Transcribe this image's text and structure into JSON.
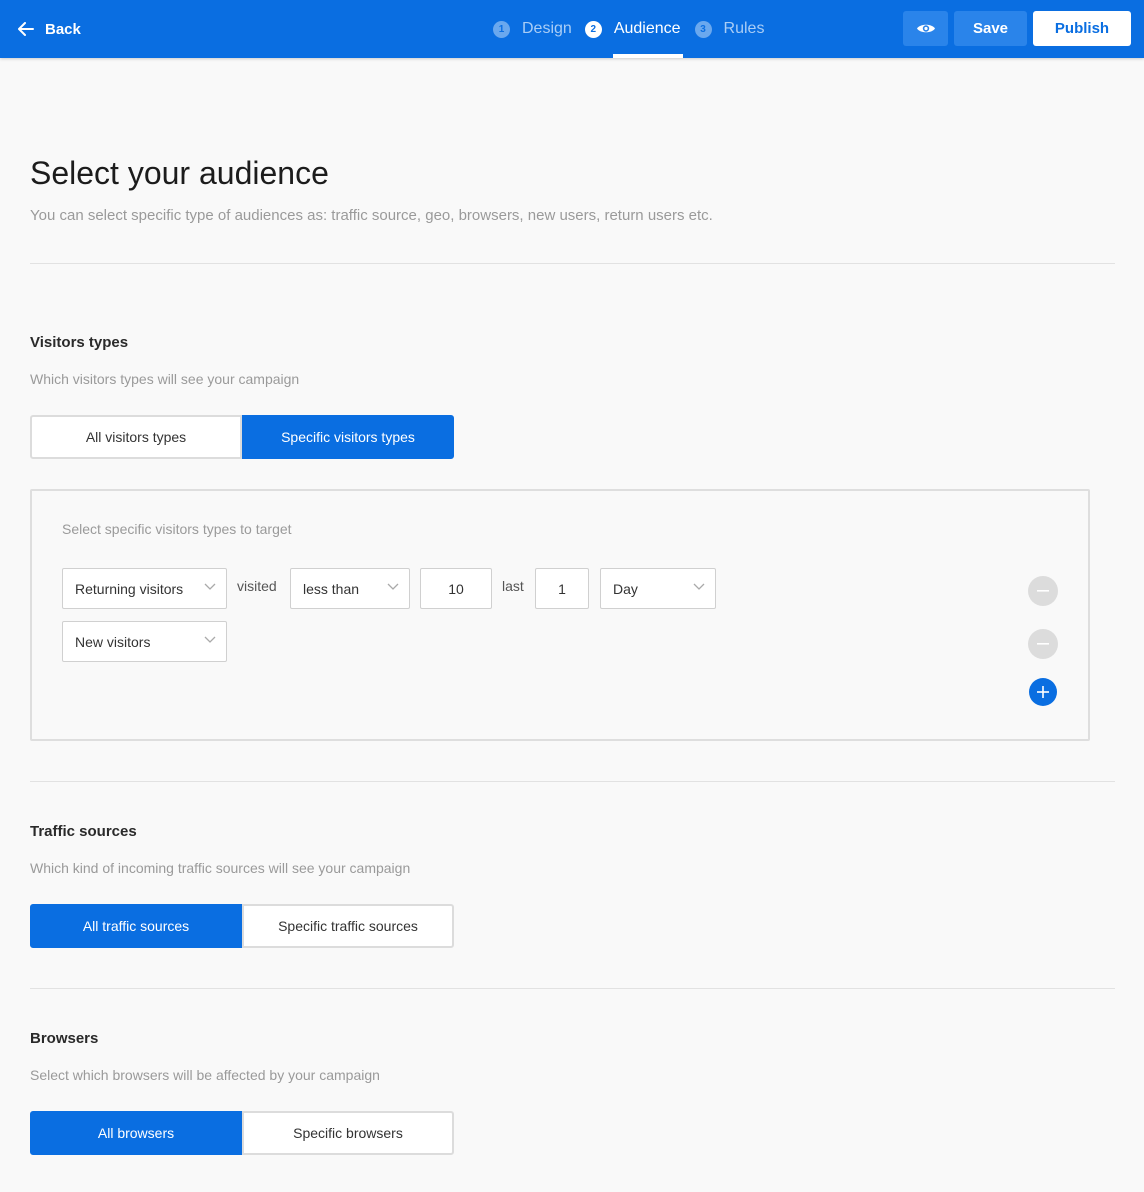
{
  "topbar": {
    "back_label": "Back",
    "steps": [
      {
        "num": "1",
        "label": "Design"
      },
      {
        "num": "2",
        "label": "Audience"
      },
      {
        "num": "3",
        "label": "Rules"
      }
    ],
    "save_label": "Save",
    "publish_label": "Publish"
  },
  "header": {
    "title": "Select your audience",
    "subtitle": "You can select specific type of audiences as: traffic source, geo, browsers, new users, return users etc."
  },
  "visitors": {
    "title": "Visitors types",
    "subtitle": "Which visitors types will see your campaign",
    "options": [
      "All visitors types",
      "Specific visitors types"
    ],
    "selected": "Specific visitors types",
    "rules_hint": "Select specific visitors types to target",
    "rule1": {
      "visitor_type": "Returning visitors",
      "visited_word": "visited",
      "comparator": "less than",
      "count": "10",
      "last_word": "last",
      "period_count": "1",
      "period_unit": "Day"
    },
    "rule2": {
      "visitor_type": "New visitors"
    }
  },
  "traffic": {
    "title": "Traffic sources",
    "subtitle": "Which kind of incoming traffic sources will see your campaign",
    "options": [
      "All traffic sources",
      "Specific traffic sources"
    ],
    "selected": "All traffic sources"
  },
  "browsers": {
    "title": "Browsers",
    "subtitle": "Select which browsers will be affected by your campaign",
    "options": [
      "All browsers",
      "Specific browsers"
    ],
    "selected": "All browsers"
  },
  "colors": {
    "accent": "#0a6ee1",
    "topbar_button": "#2a84ea",
    "muted_text": "#9a9a9a",
    "remove_button": "#dcdcdc"
  },
  "icons": [
    "back-arrow-icon",
    "eye-icon",
    "chevron-down-icon",
    "minus-icon",
    "plus-icon"
  ]
}
